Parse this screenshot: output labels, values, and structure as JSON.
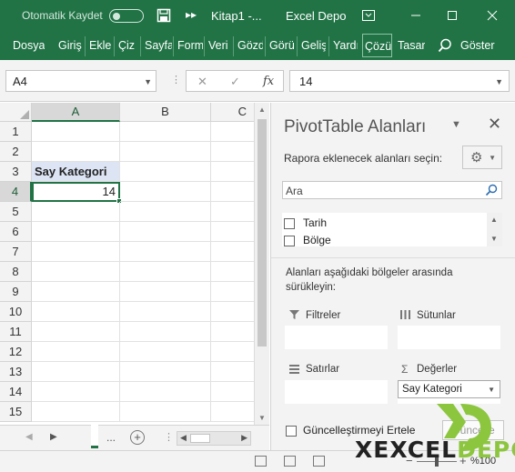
{
  "titlebar": {
    "autosave_label": "Otomatik Kaydet",
    "title": "Kitap1  -...",
    "app": "Excel Depo"
  },
  "ribbon": {
    "tabs": [
      "Dosya",
      "Giriş",
      "Ekle",
      "Çiz",
      "Sayfa",
      "Form",
      "Veri",
      "Gözd",
      "Görü",
      "Geliş",
      "Yardı",
      "Çözü",
      "Tasar"
    ],
    "active_tab": "Çözü",
    "tell_me": "Göster"
  },
  "formula_bar": {
    "name_box": "A4",
    "cancel_icon": "✕",
    "enter_icon": "✓",
    "fx_label": "fx",
    "value": "14"
  },
  "grid": {
    "columns": [
      "A",
      "B",
      "C"
    ],
    "selected_column": "A",
    "rows": [
      "1",
      "2",
      "3",
      "4",
      "5",
      "6",
      "7",
      "8",
      "9",
      "10",
      "11",
      "12",
      "13",
      "14",
      "15"
    ],
    "selected_row": "4",
    "cells": {
      "A3": "Say Kategori",
      "A4": "14"
    }
  },
  "sheetbar": {
    "ellipsis": "..."
  },
  "statusbar": {
    "zoom": "%100"
  },
  "pivot": {
    "title": "PivotTable Alanları",
    "choose_label": "Rapora eklenecek alanları seçin:",
    "search_placeholder": "Ara",
    "fields": [
      {
        "label": "Tarih",
        "checked": false
      },
      {
        "label": "Bölge",
        "checked": false
      }
    ],
    "drag_hint": "Alanları aşağıdaki bölgeler arasında sürükleyin:",
    "areas": {
      "filters": "Filtreler",
      "columns": "Sütunlar",
      "rows": "Satırlar",
      "values": "Değerler"
    },
    "values_pill": "Say Kategori",
    "defer_label": "Güncelleştirmeyi Ertele",
    "update_button": "Güncelle"
  },
  "watermark": {
    "text_dark": "XEXCEL",
    "text_green": "DEPO"
  },
  "colors": {
    "accent": "#217346",
    "header_fill": "#dde5f5",
    "logo_green": "#8cc63f"
  }
}
